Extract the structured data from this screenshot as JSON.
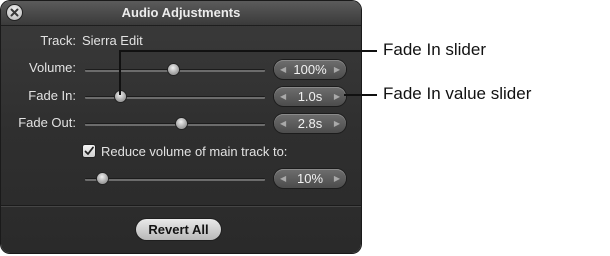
{
  "window": {
    "title": "Audio Adjustments"
  },
  "track": {
    "label": "Track:",
    "value": "Sierra Edit"
  },
  "volume": {
    "label": "Volume:",
    "value": "100%"
  },
  "fade_in": {
    "label": "Fade In:",
    "value": "1.0s"
  },
  "fade_out": {
    "label": "Fade Out:",
    "value": "2.8s"
  },
  "reduce": {
    "label": "Reduce volume of main track to:",
    "checked": true,
    "value": "10%"
  },
  "revert_label": "Revert All",
  "callouts": {
    "slider": "Fade In slider",
    "value_slider": "Fade In value slider"
  },
  "arrows": {
    "left": "◀",
    "right": "▶"
  }
}
